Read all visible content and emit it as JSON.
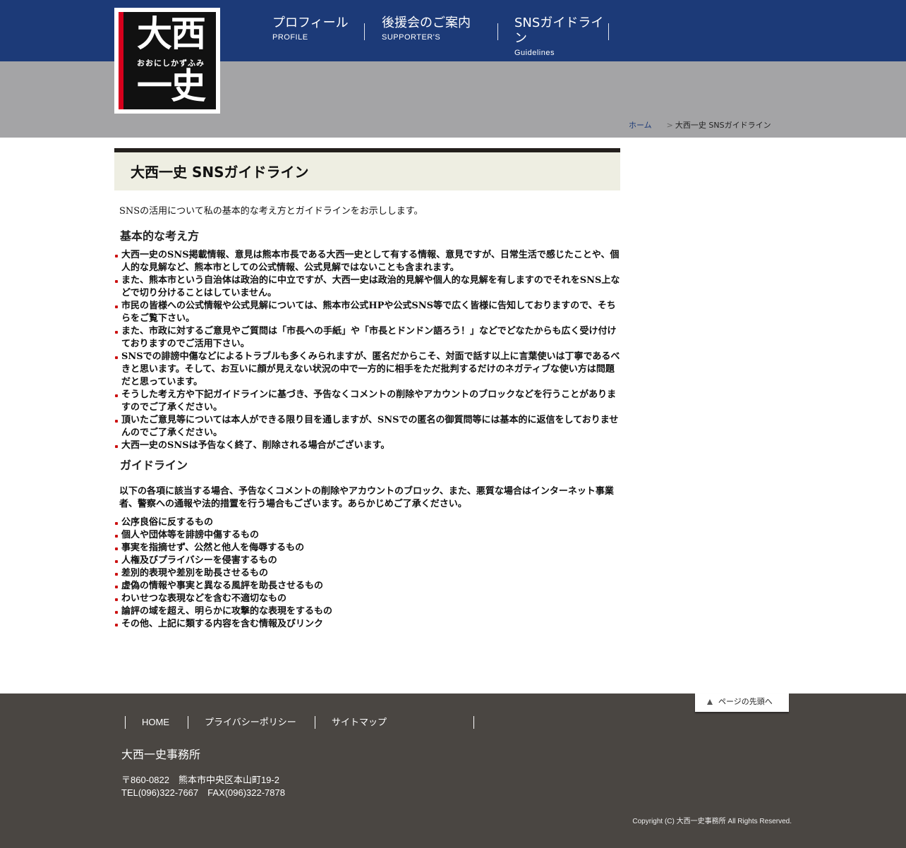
{
  "header": {
    "logo": {
      "line1": "大西",
      "reading": "おおにしかずふみ",
      "line2": "一史",
      "red_bar_color": "#d6001c"
    },
    "nav": [
      {
        "label": "プロフィール",
        "sub": "PROFILE"
      },
      {
        "label": "後援会のご案内",
        "sub": "SUPPORTER'S"
      },
      {
        "label": "SNSガイドライン",
        "sub": "Guidelines"
      }
    ],
    "bar_color": "#1c3a78"
  },
  "breadcrumb": {
    "home": "ホーム",
    "separator": ">",
    "current": "大西一史 SNSガイドライン"
  },
  "main": {
    "title": "大西一史 SNSガイドライン",
    "lead": "SNSの活用について私の基本的な考え方とガイドラインをお示しします。",
    "basic_heading": "基本的な考え方",
    "basic_items": [
      "大西一史のSNS掲載情報、意見は熊本市長である大西一史として有する情報、意見ですが、日常生活で感じたことや、個人的な見解など、熊本市としての公式情報、公式見解ではないことも含まれます。",
      "また、熊本市という自治体は政治的に中立ですが、大西一史は政治的見解や個人的な見解を有しますのでそれをSNS上などで切り分けることはしていません。",
      "市民の皆様への公式情報や公式見解については、熊本市公式HPや公式SNS等で広く皆様に告知しておりますので、そちらをご覧下さい。",
      "また、市政に対するご意見やご質問は「市長への手紙」や「市長とドンドン語ろう！」などでどなたからも広く受け付けておりますのでご活用下さい。",
      "SNSでの誹謗中傷などによるトラブルも多くみられますが、匿名だからこそ、対面で話す以上に言葉使いは丁寧であるべきと思います。そして、お互いに顔が見えない状況の中で一方的に相手をただ批判するだけのネガティブな使い方は問題だと思っています。",
      "そうした考え方や下記ガイドラインに基づき、予告なくコメントの削除やアカウントのブロックなどを行うことがありますのでご了承ください。",
      "頂いたご意見等については本人ができる限り目を通しますが、SNSでの匿名の御質問等には基本的に返信をしておりませんのでご了承ください。",
      "大西一史のSNSは予告なく終了、削除される場合がございます。"
    ],
    "guide_heading": "ガイドライン",
    "guide_lead": "以下の各項に該当する場合、予告なくコメントの削除やアカウントのブロック、また、悪質な場合はインターネット事業者、警察への通報や法的措置を行う場合もございます。あらかじめご了承ください。",
    "guide_items": [
      "公序良俗に反するもの",
      "個人や団体等を誹謗中傷するもの",
      "事実を指摘せず、公然と他人を侮辱するもの",
      "人権及びプライバシーを侵害するもの",
      "差別的表現や差別を助長させるもの",
      "虚偽の情報や事実と異なる風評を助長させるもの",
      "わいせつな表現などを含む不適切なもの",
      "論評の域を超え、明らかに攻撃的な表現をするもの",
      "その他、上記に類する内容を含む情報及びリンク"
    ],
    "bullet_color": "#cc1111"
  },
  "footer": {
    "pagetop": "ページの先頭へ",
    "nav": [
      "HOME",
      "プライバシーポリシー",
      "サイトマップ"
    ],
    "office_name": "大西一史事務所",
    "address": "〒860-0822　熊本市中央区本山町19-2",
    "tel": "TEL(096)322-7667　FAX(096)322-7878",
    "copyright": "Copyright (C) 大西一史事務所 All Rights Reserved.",
    "bg_color": "#4a4642"
  }
}
